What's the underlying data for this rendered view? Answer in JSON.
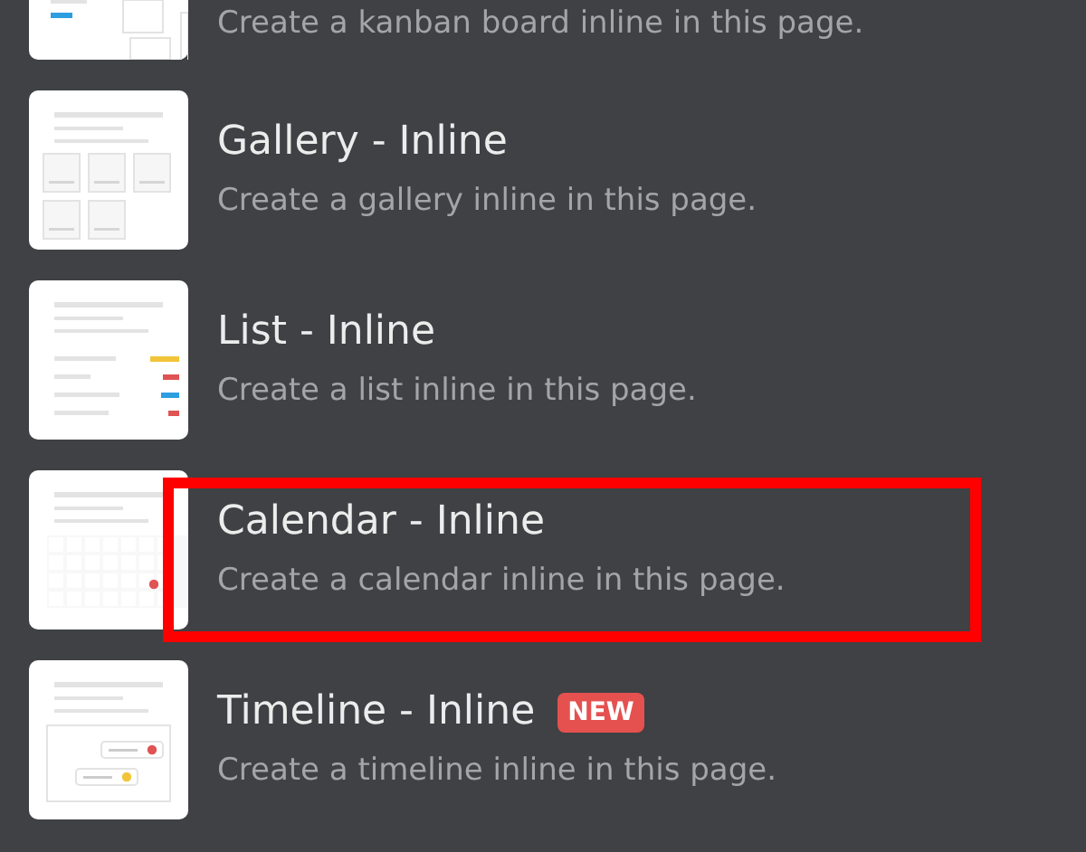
{
  "items": [
    {
      "kind": "kanban",
      "description": "Create a kanban board inline in this page.",
      "highlighted": false
    },
    {
      "kind": "gallery",
      "title": "Gallery - Inline",
      "description": "Create a gallery inline in this page.",
      "highlighted": false
    },
    {
      "kind": "list",
      "title": "List - Inline",
      "description": "Create a list inline in this page.",
      "highlighted": false
    },
    {
      "kind": "calendar",
      "title": "Calendar - Inline",
      "description": "Create a calendar inline in this page.",
      "highlighted": true
    },
    {
      "kind": "timeline",
      "title": "Timeline - Inline",
      "badge": "NEW",
      "description": "Create a timeline inline in this page.",
      "highlighted": false
    }
  ]
}
